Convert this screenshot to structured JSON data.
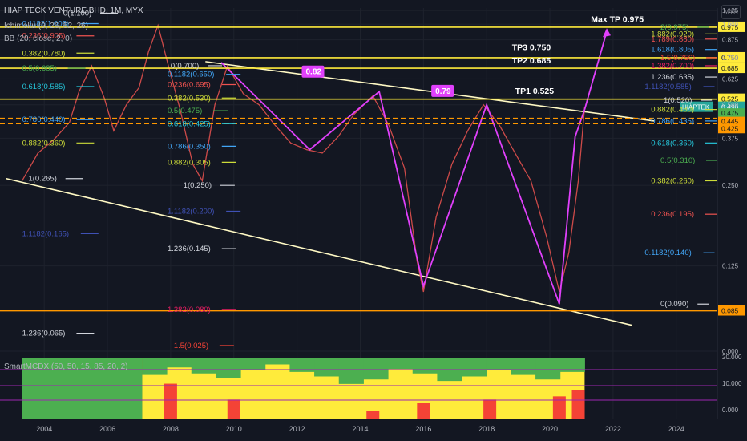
{
  "header": {
    "title": "HIAP TECK VENTURE BHD, 1M, MYX",
    "indicator1": "Ichimoku (9, 26, 52, 26)",
    "indicator2": "BB (20, close, 2, 0)",
    "subchart_title": "SmartMCDX (50, 50, 15, 85, 20, 2)",
    "currency_badge": "MYR"
  },
  "chart_data": {
    "type": "line",
    "title": "HIAP TECK VENTURE BHD, 1M, MYX",
    "x_ticks": [
      "2004",
      "2006",
      "2008",
      "2010",
      "2012",
      "2014",
      "2016",
      "2018",
      "2020",
      "2022",
      "2024"
    ],
    "y_ticks": [
      "1.125",
      "1.000",
      "0.875",
      "0.750",
      "0.625",
      "0.500",
      "0.375",
      "0.250",
      "0.125",
      "0.000"
    ],
    "yscale": "log",
    "ylim": [
      0.06,
      1.15
    ],
    "xlim": [
      2002.6,
      2025.3
    ],
    "horizontal_levels": [
      {
        "label": "0.975",
        "value": 0.975,
        "color": "#ffeb3b"
      },
      {
        "label": "0.750",
        "value": 0.75,
        "color": "#ffeb3b"
      },
      {
        "label": "0.685",
        "value": 0.685,
        "color": "#ffeb3b"
      },
      {
        "label": "0.525",
        "value": 0.525,
        "color": "#ffeb3b"
      },
      {
        "label": "0.085",
        "value": 0.085,
        "color": "#ff9800"
      }
    ],
    "dashed_levels": [
      {
        "label": "0.445",
        "value": 0.445,
        "color": "#ff9800"
      },
      {
        "label": "0.425",
        "value": 0.425,
        "color": "#ff9800"
      }
    ],
    "price_badges": [
      {
        "label": "HIAPTEK",
        "value": 0.49,
        "color": "#26a69a"
      },
      {
        "label": "0.490",
        "value": 0.49,
        "color": "#26a69a"
      },
      {
        "label": "15d 4h",
        "value": 0.47,
        "color": "#26a69a"
      },
      {
        "label": "0.475",
        "value": 0.475,
        "color": "#4caf50"
      },
      {
        "label": "0.445",
        "value": 0.445,
        "color": "#ff9800"
      },
      {
        "label": "0.425",
        "value": 0.425,
        "color": "#ff9800"
      }
    ],
    "annotations": [
      {
        "text": "Max TP 0.975",
        "x": 2021.3,
        "y": 1.02
      },
      {
        "text": "TP3 0.750",
        "x": 2018.8,
        "y": 0.8
      },
      {
        "text": "TP2 0.685",
        "x": 2018.8,
        "y": 0.715
      },
      {
        "text": "TP1 0.525",
        "x": 2018.9,
        "y": 0.55
      }
    ],
    "markers": [
      {
        "text": "0.82",
        "x": 2012.2,
        "y": 0.65
      },
      {
        "text": "0.79",
        "x": 2016.3,
        "y": 0.55
      }
    ],
    "fib_left": [
      {
        "text": "0(1.100)",
        "x": 2004.6,
        "y": 1.1,
        "color": "#d1d4dc"
      },
      {
        "text": "0.1182(1.005)",
        "x": 2003.3,
        "y": 1.005,
        "color": "#42a5f5"
      },
      {
        "text": "0.236(0.905)",
        "x": 2003.3,
        "y": 0.905,
        "color": "#ef5350"
      },
      {
        "text": "0.382(0.780)",
        "x": 2003.3,
        "y": 0.78,
        "color": "#cddc39"
      },
      {
        "text": "0.5(0.685)",
        "x": 2003.3,
        "y": 0.685,
        "color": "#4caf50"
      },
      {
        "text": "0.618(0.585)",
        "x": 2003.3,
        "y": 0.585,
        "color": "#26c6da"
      },
      {
        "text": "0.786(0.440)",
        "x": 2003.3,
        "y": 0.44,
        "color": "#42a5f5"
      },
      {
        "text": "0.882(0.360)",
        "x": 2003.3,
        "y": 0.36,
        "color": "#cddc39"
      },
      {
        "text": "1(0.265)",
        "x": 2003.5,
        "y": 0.265,
        "color": "#d1d4dc"
      },
      {
        "text": "1.1182(0.165)",
        "x": 2003.3,
        "y": 0.165,
        "color": "#3f51b5"
      },
      {
        "text": "1.236(0.065)",
        "x": 2003.3,
        "y": 0.07,
        "color": "#d1d4dc"
      }
    ],
    "fib_mid": [
      {
        "text": "0(0.700)",
        "x": 2008.0,
        "y": 0.7,
        "color": "#d1d4dc"
      },
      {
        "text": "0.1182(0.650)",
        "x": 2007.9,
        "y": 0.65,
        "color": "#42a5f5"
      },
      {
        "text": "0.236(0.695)",
        "x": 2007.9,
        "y": 0.595,
        "color": "#ef5350"
      },
      {
        "text": "0.382(0.530)",
        "x": 2007.9,
        "y": 0.53,
        "color": "#cddc39"
      },
      {
        "text": "0.5(0.475)",
        "x": 2007.9,
        "y": 0.475,
        "color": "#4caf50"
      },
      {
        "text": "0.618(0.425)",
        "x": 2007.9,
        "y": 0.425,
        "color": "#26c6da"
      },
      {
        "text": "0.786(0.350)",
        "x": 2007.9,
        "y": 0.35,
        "color": "#42a5f5"
      },
      {
        "text": "0.882(0.305)",
        "x": 2007.9,
        "y": 0.305,
        "color": "#cddc39"
      },
      {
        "text": "1(0.250)",
        "x": 2008.4,
        "y": 0.25,
        "color": "#d1d4dc"
      },
      {
        "text": "1.1182(0.200)",
        "x": 2007.9,
        "y": 0.2,
        "color": "#3f51b5"
      },
      {
        "text": "1.236(0.145)",
        "x": 2007.9,
        "y": 0.145,
        "color": "#d1d4dc"
      },
      {
        "text": "1.382(0.080)",
        "x": 2007.9,
        "y": 0.086,
        "color": "#e91e63"
      },
      {
        "text": "1.5(0.025)",
        "x": 2008.1,
        "y": 0.063,
        "color": "#f44336"
      }
    ],
    "fib_right": [
      {
        "text": "2(0.975)",
        "x": 2023.5,
        "y": 0.975,
        "color": "#4caf50"
      },
      {
        "text": "1.882(0.920)",
        "x": 2023.2,
        "y": 0.92,
        "color": "#cddc39"
      },
      {
        "text": "1.789(0.880)",
        "x": 2023.2,
        "y": 0.88,
        "color": "#ef5350"
      },
      {
        "text": "1.618(0.805)",
        "x": 2023.2,
        "y": 0.805,
        "color": "#42a5f5"
      },
      {
        "text": "1.5(0.750)",
        "x": 2023.5,
        "y": 0.75,
        "color": "#f44336"
      },
      {
        "text": "1.382(0.700)",
        "x": 2023.2,
        "y": 0.7,
        "color": "#e91e63"
      },
      {
        "text": "1.236(0.635)",
        "x": 2023.2,
        "y": 0.635,
        "color": "#d1d4dc"
      },
      {
        "text": "1.1182(0.585)",
        "x": 2023.0,
        "y": 0.585,
        "color": "#3f51b5"
      },
      {
        "text": "1(0.520)",
        "x": 2023.6,
        "y": 0.52,
        "color": "#d1d4dc"
      },
      {
        "text": "0.882(0.480)",
        "x": 2023.2,
        "y": 0.48,
        "color": "#cddc39"
      },
      {
        "text": "0.786(0.435)",
        "x": 2023.2,
        "y": 0.435,
        "color": "#42a5f5"
      },
      {
        "text": "0.618(0.360)",
        "x": 2023.2,
        "y": 0.36,
        "color": "#26c6da"
      },
      {
        "text": "0.5(0.310)",
        "x": 2023.5,
        "y": 0.31,
        "color": "#4caf50"
      },
      {
        "text": "0.382(0.260)",
        "x": 2023.2,
        "y": 0.26,
        "color": "#cddc39"
      },
      {
        "text": "0.236(0.195)",
        "x": 2023.2,
        "y": 0.195,
        "color": "#ef5350"
      },
      {
        "text": "0.1182(0.140)",
        "x": 2023.0,
        "y": 0.14,
        "color": "#42a5f5"
      },
      {
        "text": "0(0.090)",
        "x": 2023.5,
        "y": 0.09,
        "color": "#d1d4dc"
      }
    ],
    "wedge_upper": [
      [
        2009.1,
        0.725
      ],
      [
        2023.3,
        0.435
      ]
    ],
    "wedge_lower": [
      [
        2002.8,
        0.265
      ],
      [
        2022.6,
        0.075
      ]
    ],
    "zigzag": [
      [
        2009.6,
        0.72
      ],
      [
        2012.4,
        0.34
      ],
      [
        2014.6,
        0.56
      ],
      [
        2016.0,
        0.105
      ],
      [
        2018.0,
        0.5
      ],
      [
        2020.3,
        0.09
      ],
      [
        2020.8,
        0.38
      ],
      [
        2021.1,
        0.48
      ]
    ],
    "projection_arrow": [
      [
        2021.1,
        0.48
      ],
      [
        2021.8,
        0.94
      ]
    ],
    "price_path": [
      [
        2003.3,
        0.26
      ],
      [
        2003.8,
        0.33
      ],
      [
        2004.3,
        0.37
      ],
      [
        2004.8,
        0.43
      ],
      [
        2005.1,
        0.56
      ],
      [
        2005.5,
        0.7
      ],
      [
        2005.9,
        0.53
      ],
      [
        2006.2,
        0.4
      ],
      [
        2006.6,
        0.5
      ],
      [
        2007.0,
        0.58
      ],
      [
        2007.3,
        0.79
      ],
      [
        2007.6,
        0.99
      ],
      [
        2007.9,
        0.72
      ],
      [
        2008.3,
        0.48
      ],
      [
        2008.7,
        0.3
      ],
      [
        2009.0,
        0.26
      ],
      [
        2009.4,
        0.5
      ],
      [
        2009.8,
        0.7
      ],
      [
        2010.3,
        0.55
      ],
      [
        2010.8,
        0.5
      ],
      [
        2011.3,
        0.42
      ],
      [
        2011.8,
        0.36
      ],
      [
        2012.3,
        0.34
      ],
      [
        2012.8,
        0.33
      ],
      [
        2013.3,
        0.38
      ],
      [
        2013.8,
        0.46
      ],
      [
        2014.4,
        0.54
      ],
      [
        2014.9,
        0.42
      ],
      [
        2015.4,
        0.29
      ],
      [
        2015.8,
        0.13
      ],
      [
        2016.0,
        0.1
      ],
      [
        2016.4,
        0.19
      ],
      [
        2016.9,
        0.3
      ],
      [
        2017.4,
        0.4
      ],
      [
        2017.9,
        0.5
      ],
      [
        2018.4,
        0.42
      ],
      [
        2018.9,
        0.33
      ],
      [
        2019.4,
        0.26
      ],
      [
        2019.9,
        0.16
      ],
      [
        2020.3,
        0.1
      ],
      [
        2020.6,
        0.14
      ],
      [
        2020.9,
        0.26
      ],
      [
        2021.1,
        0.49
      ]
    ],
    "volume_axis_ticks": [
      "20.000",
      "10.000",
      "0.000"
    ]
  }
}
